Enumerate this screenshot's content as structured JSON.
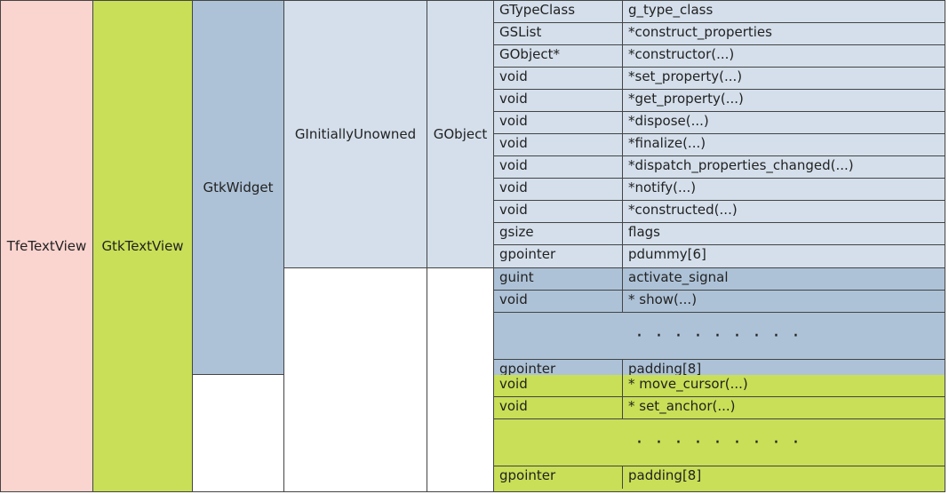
{
  "columns": {
    "tfe": "TfeTextView",
    "gtktextview": "GtkTextView",
    "gtkwidget": "GtkWidget",
    "ginitiallyunowned": "GInitiallyUnowned",
    "gobject": "GObject"
  },
  "gobject_members": [
    {
      "type": "GTypeClass",
      "name": "g_type_class"
    },
    {
      "type": "GSList",
      "name": "*construct_properties"
    },
    {
      "type": "GObject*",
      "name": "*constructor(...)"
    },
    {
      "type": "void",
      "name": "*set_property(...)"
    },
    {
      "type": "void",
      "name": "*get_property(...)"
    },
    {
      "type": "void",
      "name": "*dispose(...)"
    },
    {
      "type": "void",
      "name": "*finalize(...)"
    },
    {
      "type": "void",
      "name": "*dispatch_properties_changed(...)"
    },
    {
      "type": "void",
      "name": "*notify(...)"
    },
    {
      "type": "void",
      "name": "*constructed(...)"
    },
    {
      "type": "gsize",
      "name": "flags"
    },
    {
      "type": "gpointer",
      "name": "pdummy[6]"
    }
  ],
  "gtkwidget_members_head": [
    {
      "type": "guint",
      "name": "activate_signal"
    },
    {
      "type": "void",
      "name": "* show(...)"
    }
  ],
  "gtkwidget_dots": "· · ·    · · ·   · · ·",
  "gtkwidget_members_tail": [
    {
      "type": "gpointer",
      "name": "padding[8]"
    }
  ],
  "gtktextview_members_head": [
    {
      "type": "void",
      "name": "* move_cursor(...)"
    },
    {
      "type": "void",
      "name": "* set_anchor(...)"
    }
  ],
  "gtktextview_dots": "· · ·    · · ·   · · ·",
  "gtktextview_members_tail": [
    {
      "type": "gpointer",
      "name": "padding[8]"
    }
  ]
}
